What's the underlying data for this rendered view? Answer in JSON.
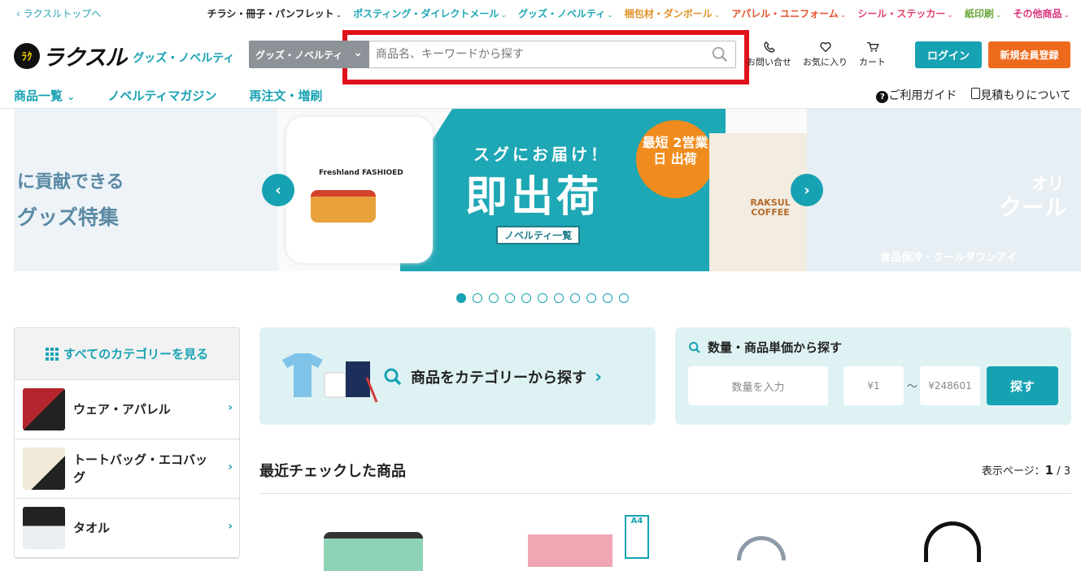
{
  "topbar": {
    "back_link": "ラクスルトップへ",
    "nav": [
      {
        "label": "チラシ・冊子・パンフレット",
        "color": "#222222"
      },
      {
        "label": "ポスティング・ダイレクトメール",
        "color": "#1ea7b4"
      },
      {
        "label": "グッズ・ノベルティ",
        "color": "#1ea7b4"
      },
      {
        "label": "梱包材・ダンボール",
        "color": "#e0932a"
      },
      {
        "label": "アパレル・ユニフォーム",
        "color": "#e2542d"
      },
      {
        "label": "シール・ステッカー",
        "color": "#e0426a"
      },
      {
        "label": "紙印刷",
        "color": "#6aa83b"
      },
      {
        "label": "その他商品",
        "color": "#d8327a"
      }
    ]
  },
  "header": {
    "logo_mark": "ﾗｸ",
    "logo_word": "ラクスル",
    "logo_sub": "グッズ・ノベルティ",
    "category_select": "グッズ・ノベルティ",
    "search_placeholder": "商品名、キーワードから探す",
    "icons": [
      {
        "name": "phone-icon",
        "label": "お問い合せ"
      },
      {
        "name": "heart-icon",
        "label": "お気に入り"
      },
      {
        "name": "cart-icon",
        "label": "カート"
      }
    ],
    "login": "ログイン",
    "register": "新規会員登録"
  },
  "subnav": {
    "left": [
      "商品一覧",
      "ノベルティマガジン",
      "再注文・増刷"
    ],
    "guide": "ご利用ガイド",
    "estimate": "見積もりについて"
  },
  "banner": {
    "left_line1": "に貢献できる",
    "left_line2": "グッズ特集",
    "tshirt_text": "Freshland FASHIOED",
    "headline_small": "スグにお届け！",
    "headline_big": "即出荷",
    "label": "ノベルティ一覧",
    "badge": "最短 2営業日 出荷",
    "bag_text": "RAKSUL COFFEE",
    "right_line1": "オリ",
    "right_line2": "クール",
    "right_line3": "食品保冷・クールダウンアイ",
    "dots_total": 11,
    "dots_active": 0
  },
  "categories": {
    "header": "すべてのカテゴリーを見る",
    "items": [
      "ウェア・アパレル",
      "トートバッグ・エコバッグ",
      "タオル"
    ]
  },
  "category_search": "商品をカテゴリーから探す",
  "quantity_search": {
    "title": "数量・商品単価から探す",
    "qty_placeholder": "数量を入力",
    "min_placeholder": "¥1",
    "tilde": "〜",
    "max_placeholder": "¥248601",
    "button": "探す"
  },
  "recent": {
    "title": "最近チェックした商品",
    "page_label": "表示ページ：",
    "page_current": "1",
    "page_total": "/ 3"
  }
}
